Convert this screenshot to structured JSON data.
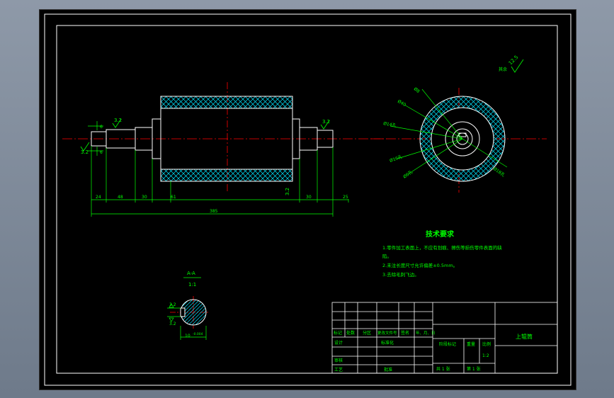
{
  "drawing": {
    "surface_roughness_main": "12.5",
    "surface_roughness_note": "其余",
    "dims_bottom": [
      "24",
      "48",
      "30",
      "61",
      "30",
      "25"
    ],
    "dim_total": "385",
    "dim_small_6a": "6",
    "dim_small_6b": "6",
    "rough_left_1": "3.2",
    "rough_left_2": "3.2",
    "rough_right_1": "3.2",
    "rough_right_2": "3.2",
    "circle_labels": [
      "Ø8",
      "Ø40",
      "Ø14孔",
      "Ø16孔",
      "Ø6孔",
      "Ø18孔"
    ]
  },
  "section": {
    "title": "A-A",
    "scale": "1:1",
    "dim_width": "10",
    "tol": "-0.004",
    "rough_1": "3.2",
    "rough_2": "3.2"
  },
  "tech": {
    "title": "技术要求",
    "line1": "1.零件加工表面上，不应有划痕、擦伤等损伤零件表面的缺",
    "line1b": "陷。",
    "line2": "2.未注长度尺寸允许偏差±0.5mm。",
    "line3": "3.去除毛刺飞边。"
  },
  "title_block": {
    "part_name": "上辊筒",
    "headers": [
      "标记",
      "处数",
      "分区",
      "更改文件号",
      "签名",
      "年、月、日"
    ],
    "design": "设计",
    "standard": "标准化",
    "review": "审核",
    "process": "工艺",
    "approve": "批准",
    "stage": "阶段标记",
    "weight": "重量",
    "scale": "比例",
    "scale_val": "1:2",
    "sheets_total": "共 1 张",
    "sheet_no": "第 1 张"
  },
  "colors": {
    "line": "#ffffff",
    "dim": "#00ff00",
    "center": "#ff0000",
    "hatch": "#00e5ff"
  }
}
